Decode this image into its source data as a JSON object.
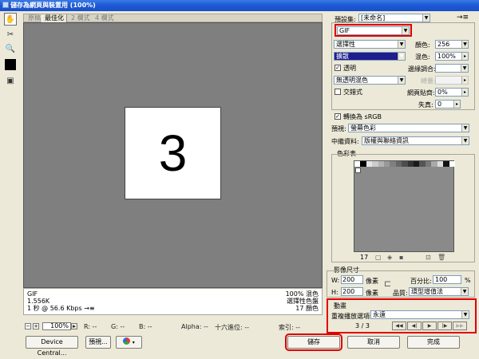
{
  "window": {
    "title": "儲存為網頁與裝置用 (100%)"
  },
  "tabs": [
    {
      "label": "原稿",
      "active": false
    },
    {
      "label": "最佳化",
      "active": true
    },
    {
      "label": "2 欄式",
      "active": false
    },
    {
      "label": "4 欄式",
      "active": false
    }
  ],
  "preview": {
    "image_text": "3"
  },
  "info_left": {
    "format": "GIF",
    "size": "1.556K",
    "time": "1 秒 @ 56.6 Kbps",
    "menu_glyph": "→≡"
  },
  "info_right": {
    "dither": "100% 混色",
    "palette": "選擇性色盤",
    "colors": "17 顏色"
  },
  "status": {
    "zoom": "100%",
    "r": "R: --",
    "g": "G: --",
    "b": "B: --",
    "alpha": "Alpha: --",
    "hex": "十六進位: --",
    "index": "索引: --"
  },
  "buttons": {
    "device_central": "Device Central...",
    "preview": "預視...",
    "save": "儲存",
    "cancel": "取消",
    "done": "完成"
  },
  "settings": {
    "preset_label": "預設集:",
    "preset_value": "[未命名]",
    "format": "GIF",
    "reduction": "選擇性",
    "colors_label": "顏色:",
    "colors_value": "256",
    "dither_algo": "擴散",
    "dither_label": "混色:",
    "dither_value": "100%",
    "transparency_label": "透明",
    "matte_label": "邊緣調合:",
    "trans_dither": "無透明混色",
    "amount_label": "總量:",
    "interlaced_label": "交錯式",
    "websnap_label": "網頁貼齊:",
    "websnap_value": "0%",
    "lossy_label": "失真:",
    "lossy_value": "0",
    "srgb_label": "轉換為 sRGB",
    "preview_label": "預視:",
    "preview_value": "螢幕色彩",
    "metadata_label": "中繼資料:",
    "metadata_value": "版權與聯絡資訊"
  },
  "color_table": {
    "title": "色彩表",
    "count": "17"
  },
  "image_size": {
    "title": "影像尺寸",
    "w_label": "W:",
    "w_value": "200",
    "w_unit": "像素",
    "h_label": "H:",
    "h_value": "200",
    "h_unit": "像素",
    "percent_label": "百分比:",
    "percent_value": "100",
    "percent_unit": "%",
    "quality_label": "品質:",
    "quality_value": "環型增值法"
  },
  "animation": {
    "title": "動畫",
    "loop_label": "重複播放選項:",
    "loop_value": "永遠",
    "frame_counter": "3 / 3"
  },
  "colors": {
    "accent_red": "#e00000",
    "title_blue": "#1c5ad8",
    "dither_blue": "#1e1e8c"
  }
}
